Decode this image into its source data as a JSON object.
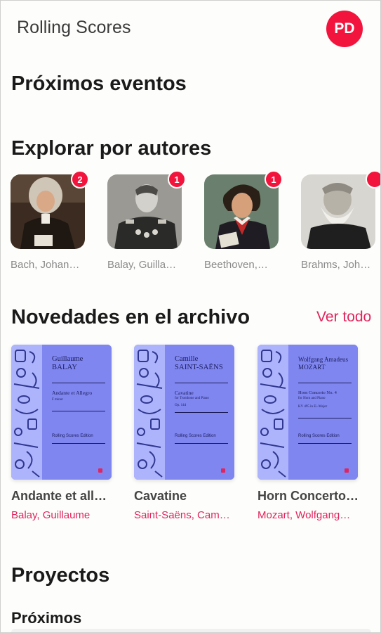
{
  "app": {
    "title": "Rolling Scores",
    "avatar_initials": "PD"
  },
  "colors": {
    "accent": "#e0245e",
    "badge": "#f2143c",
    "cover": "#7f86f0"
  },
  "sections": {
    "upcoming_events": "Próximos eventos",
    "authors": "Explorar por autores",
    "archive": "Novedades en el archivo",
    "see_all": "Ver todo",
    "projects": "Proyectos",
    "upcoming": "Próximos"
  },
  "authors": [
    {
      "name": "Bach, Johan…",
      "badge": "2"
    },
    {
      "name": "Balay, Guilla…",
      "badge": "1"
    },
    {
      "name": "Beethoven,…",
      "badge": "1"
    },
    {
      "name": "Brahms, Joh…",
      "badge": ""
    }
  ],
  "scores": [
    {
      "cover_composer_line1": "Guillaume",
      "cover_composer_line2": "BALAY",
      "cover_piece": "Andante et Allegro",
      "cover_piece_detail": "F minor",
      "cover_piece_detail2": "",
      "cover_edition": "Rolling Scores Edition",
      "title": "Andante et all…",
      "composer": "Balay, Guillaume"
    },
    {
      "cover_composer_line1": "Camille",
      "cover_composer_line2": "SAINT-SAËNS",
      "cover_piece": "Cavatine",
      "cover_piece_detail": "for Trombone and Piano",
      "cover_piece_detail2": "Op. 144",
      "cover_edition": "Rolling Scores Edition",
      "title": "Cavatine",
      "composer": "Saint-Saëns, Cam…"
    },
    {
      "cover_composer_line1": "Wolfgang Amadeus",
      "cover_composer_line2": "MOZART",
      "cover_piece": "Horn Concerto No. 4",
      "cover_piece_detail": "for Horn and Piano",
      "cover_piece_detail2": "KV 495 in E♭ Major",
      "cover_edition": "Rolling Scores Edition",
      "title": "Horn Concerto…",
      "composer": "Mozart, Wolfgang…"
    }
  ]
}
